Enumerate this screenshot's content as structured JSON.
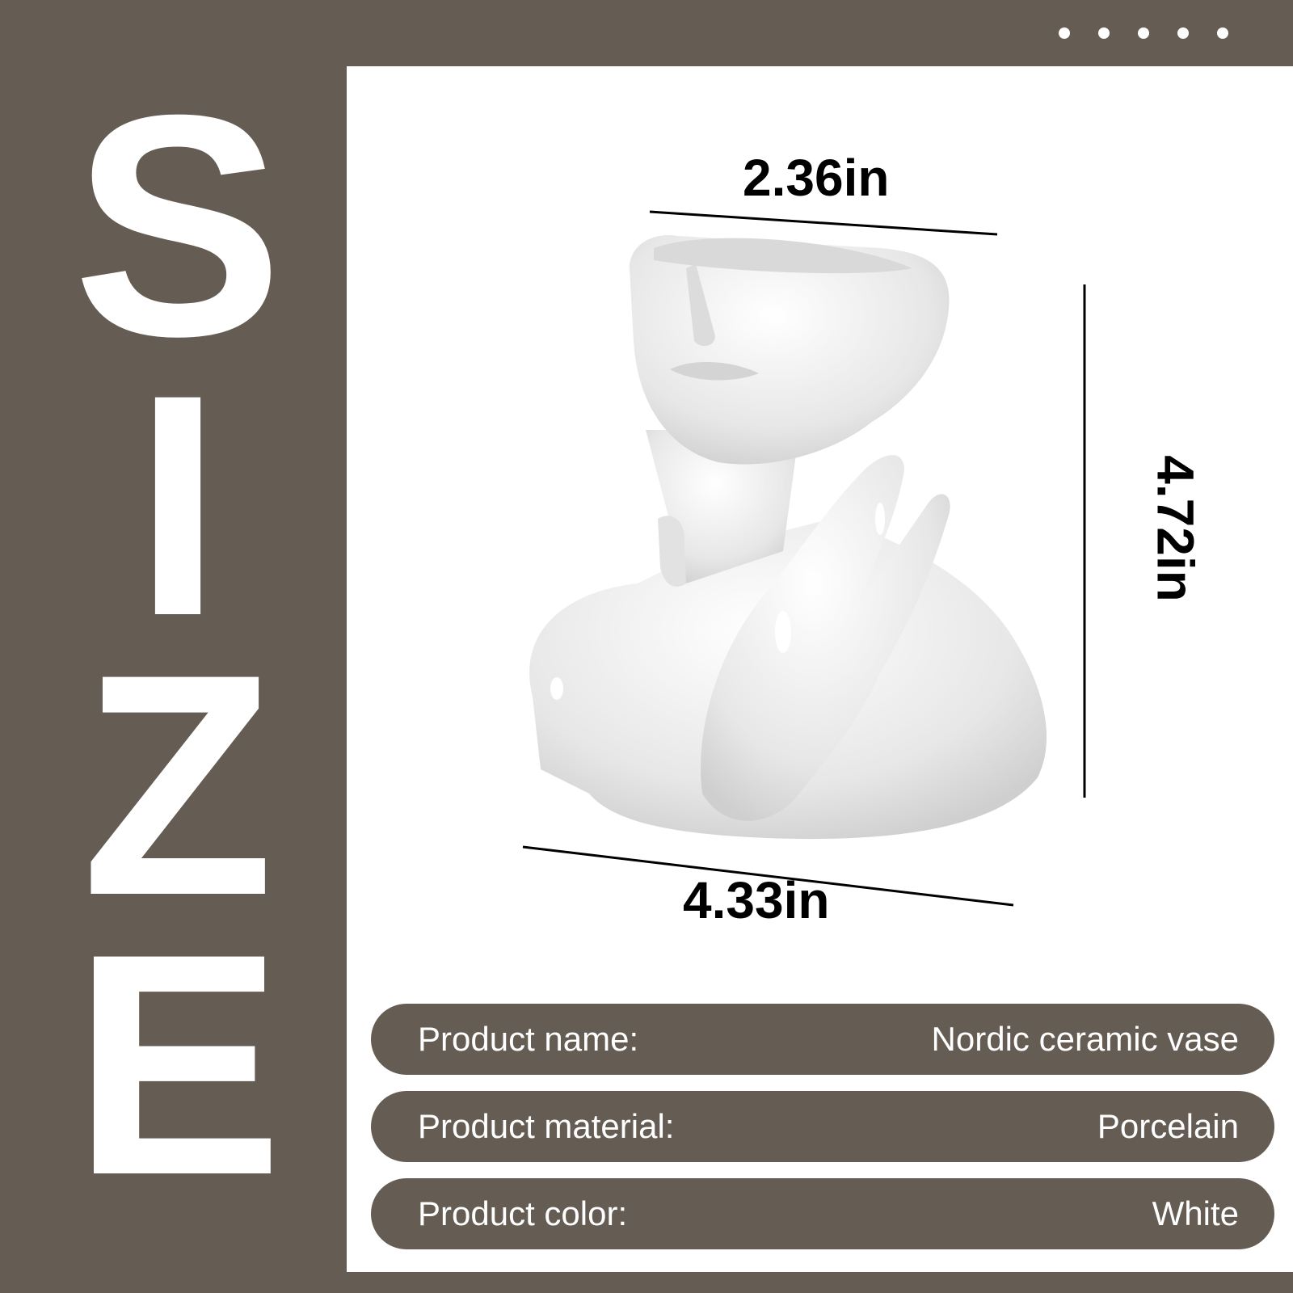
{
  "banner": {
    "letters": [
      "S",
      "I",
      "Z",
      "E"
    ]
  },
  "dimensions": {
    "top_width": "2.36in",
    "height": "4.72in",
    "bottom_width": "4.33in"
  },
  "specs": [
    {
      "label": "Product name:",
      "value": "Nordic ceramic vase"
    },
    {
      "label": "Product material:",
      "value": "Porcelain"
    },
    {
      "label": "Product color:",
      "value": "White"
    }
  ],
  "colors": {
    "background": "#655c53",
    "panel": "#ffffff",
    "text_on_dark": "#ffffff",
    "dimension_text": "#000000"
  }
}
